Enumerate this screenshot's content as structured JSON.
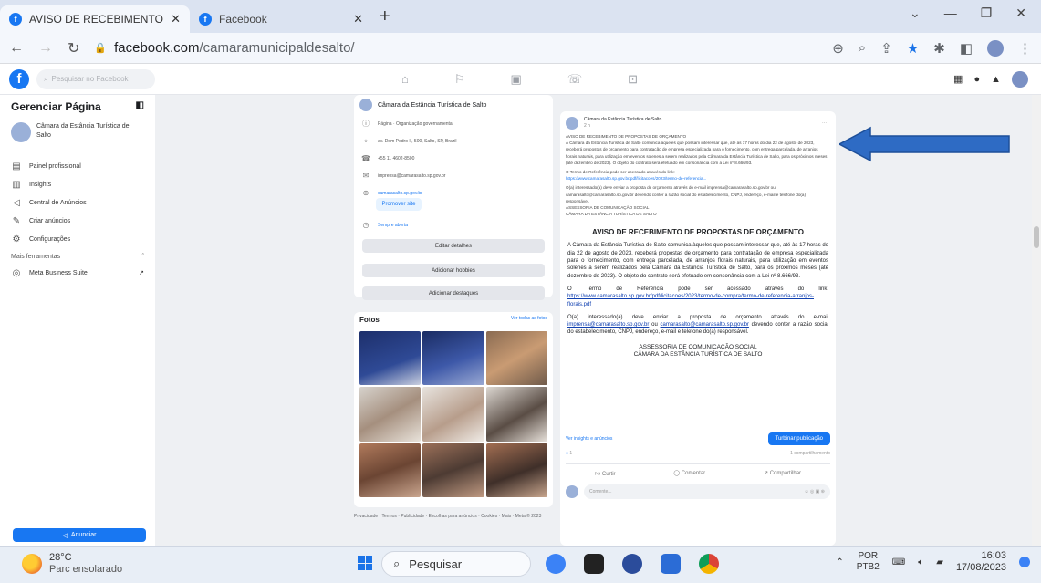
{
  "browser": {
    "tabs": [
      {
        "title": "AVISO DE RECEBIMENTO DE PRO",
        "icon": "facebook-icon"
      },
      {
        "title": "Facebook",
        "icon": "facebook-icon"
      }
    ],
    "url_domain": "facebook.com",
    "url_path": "/camaramunicipaldesalto/"
  },
  "facebook": {
    "search_placeholder": "Pesquisar no Facebook"
  },
  "sidebar": {
    "title": "Gerenciar Página",
    "page_name": "Câmara da Estância Turística de Salto",
    "items": [
      {
        "label": "Painel profissional",
        "icon": "dashboard-icon"
      },
      {
        "label": "Insights",
        "icon": "insights-icon"
      },
      {
        "label": "Central de Anúncios",
        "icon": "megaphone-icon"
      },
      {
        "label": "Criar anúncios",
        "icon": "pencil-icon"
      },
      {
        "label": "Configurações",
        "icon": "gear-icon"
      }
    ],
    "more_tools": "Mais ferramentas",
    "meta_business": "Meta Business Suite",
    "promote_button": "Anunciar"
  },
  "intro": {
    "page_name": "Câmara da Estância Turística de Salto",
    "rows": [
      {
        "icon": "info-icon",
        "text": "Página · Organização governamental"
      },
      {
        "icon": "location-icon",
        "text": "av. Dom Pedro II, 500, Salto, SP, Brazil"
      },
      {
        "icon": "phone-icon",
        "text": "+55 11 4602-8500"
      },
      {
        "icon": "mail-icon",
        "text": "imprensa@camarasalto.sp.gov.br"
      },
      {
        "icon": "globe-icon",
        "text": "camarasalto.sp.gov.br"
      }
    ],
    "promote_site": "Promover site",
    "status": "Sempre aberta",
    "buttons": [
      "Editar detalhes",
      "Adicionar hobbies",
      "Adicionar destaques"
    ]
  },
  "photos": {
    "title": "Fotos",
    "see_all": "Ver todas as fotos",
    "footer": "Privacidade · Termos · Publicidade · Escolhas para anúncios · Cookies · Mais · Meta © 2023"
  },
  "post": {
    "author": "Câmara da Estância Turística de Salto",
    "time": "2 h",
    "body": [
      "AVISO DE RECEBIMENTO DE PROPOSTAS DE ORÇAMENTO",
      "A Câmara da Estância Turística de Salto comunica àqueles que possam interessar que, até às 17 horas do dia 22 de agosto de 2023, receberá propostas de orçamento para contratação de empresa especializada para o fornecimento, com entrega parcelada, de arranjos florais naturais, para utilização em eventos solenes a serem realizados pela Câmara da Estância Turística de Salto, para os próximos meses (até dezembro de 2023). O objeto do contrato será efetuado em consonância com a Lei nº 8.666/93.",
      "O Termo de Referência pode ser acessado através do link:",
      "https://www.camarasalto.sp.gov.br/pdf/licitacoes/2023/termo-de-referencia...",
      "O(a) interessado(a) deve enviar a proposta de orçamento através do e-mail imprensa@camarasalto.sp.gov.br ou camarasalto@camarasalto.sp.gov.br devendo conter a razão social do estabelecimento, CNPJ, endereço, e-mail e telefone do(a) responsável.",
      "ASSESSORIA DE COMUNICAÇÃO SOCIAL",
      "CÂMARA DA ESTÂNCIA TURÍSTICA DE SALTO"
    ],
    "doc": {
      "title": "AVISO DE RECEBIMENTO DE PROPOSTAS DE ORÇAMENTO",
      "p1": "A Câmara da Estância Turística de Salto comunica àqueles que possam interessar que, até às 17 horas do dia 22 de agosto de 2023, receberá propostas de orçamento para contratação de empresa especializada para o fornecimento, com entrega parcelada, de arranjos florais naturais, para utilização em eventos solenes a serem realizados pela Câmara da Estância Turística de Salto, para os próximos meses (até dezembro de 2023). O objeto do contrato será efetuado em consonância com a Lei nº 8.666/93.",
      "p2_prefix": "O Termo de Referência pode ser acessado através do link:",
      "p2_link": "https://www.camarasalto.sp.gov.br/pdf/licitacoes/2023/termo-de-compra/termo-de-referencia-arranjos-florais.pdf",
      "p3_prefix": "O(a) interessado(a) deve enviar a proposta de orçamento através do e-mail",
      "p3_email1": "imprensa@camarasalto.sp.gov.br",
      "p3_or": "ou",
      "p3_email2": "camarasalto@camarasalto.sp.gov.br",
      "p3_suffix": "devendo conter a razão social do estabelecimento, CNPJ, endereço, e-mail e telefone do(a) responsável.",
      "sig1": "ASSESSORIA DE COMUNICAÇÃO SOCIAL",
      "sig2": "CÂMARA DA ESTÂNCIA TURÍSTICA DE SALTO"
    },
    "insights_link": "Ver insights e anúncios",
    "boost": "Turbinar publicação",
    "reaction_count": "1",
    "shares": "1 compartilhamento",
    "actions": [
      "Curtir",
      "Comentar",
      "Compartilhar"
    ],
    "comment_placeholder": "Comente..."
  },
  "taskbar": {
    "temp": "28°C",
    "weather": "Parc ensolarado",
    "search": "Pesquisar",
    "lang1": "POR",
    "lang2": "PTB2",
    "time": "16:03",
    "date": "17/08/2023"
  },
  "colors": {
    "facebook_blue": "#1877f2",
    "arrow_blue": "#2e6bc4"
  }
}
